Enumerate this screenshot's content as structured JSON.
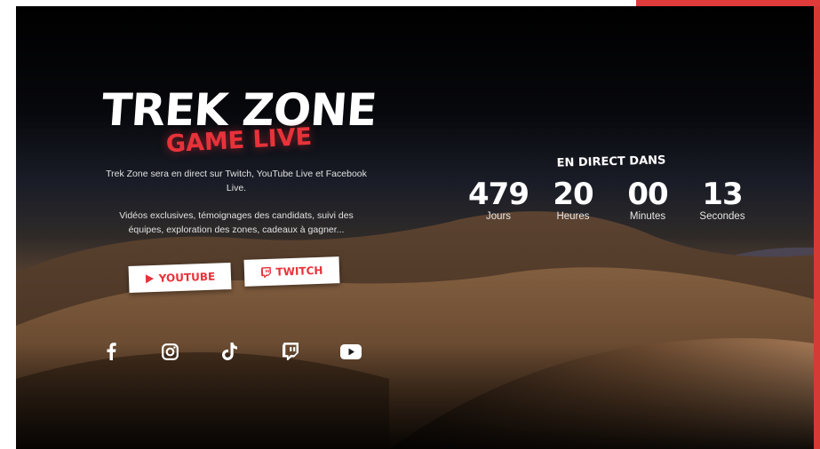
{
  "brand": {
    "title": "TREK ZONE",
    "subtitle": "GAME LIVE"
  },
  "intro": {
    "line1": "Trek Zone sera en direct sur Twitch, YouTube Live et Facebook Live.",
    "line2": "Vidéos exclusives, témoignages des candidats, suivi des équipes, exploration des zones, cadeaux à gagner..."
  },
  "buttons": {
    "youtube_label": "YOUTUBE",
    "twitch_label": "TWITCH"
  },
  "socials": [
    {
      "icon": "facebook-icon"
    },
    {
      "icon": "instagram-icon"
    },
    {
      "icon": "tiktok-icon"
    },
    {
      "icon": "twitch-icon"
    },
    {
      "icon": "youtube-icon"
    }
  ],
  "countdown": {
    "title": "EN DIRECT DANS",
    "units": [
      {
        "value": "479",
        "label": "Jours"
      },
      {
        "value": "20",
        "label": "Heures"
      },
      {
        "value": "00",
        "label": "Minutes"
      },
      {
        "value": "13",
        "label": "Secondes"
      }
    ]
  },
  "colors": {
    "accent": "#e8323a",
    "button_bg": "#ffffff",
    "text": "#ffffff"
  }
}
